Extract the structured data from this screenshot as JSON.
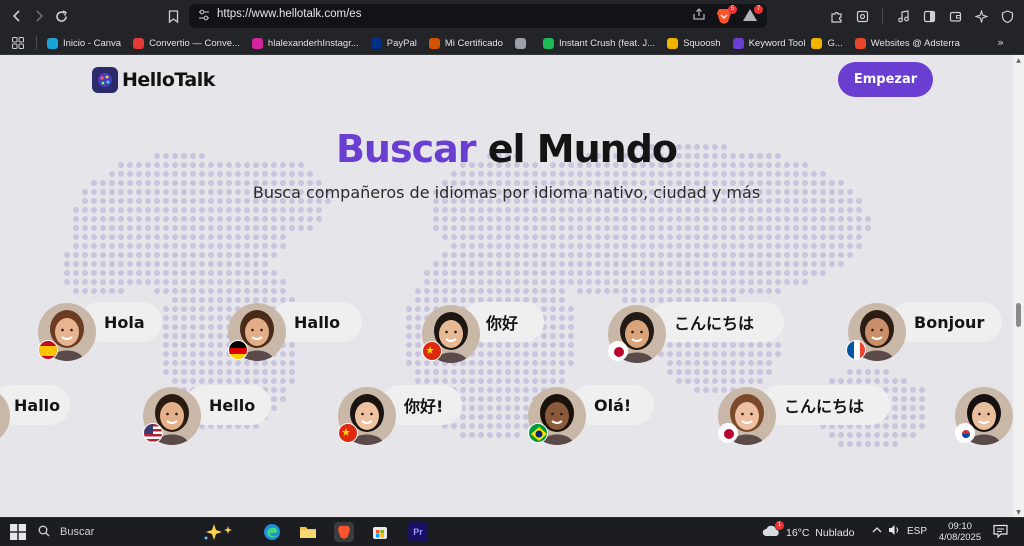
{
  "browser": {
    "url": "https://www.hellotalk.com/es",
    "brave_badge": "5",
    "aurora_badge": "7",
    "bookmarks": [
      {
        "label": "Inicio - Canva",
        "color": "#1ba4d8"
      },
      {
        "label": "Convertio — Conve...",
        "color": "#e53935"
      },
      {
        "label": "hlalexanderhInstagr...",
        "color": "#d6249f"
      },
      {
        "label": "PayPal",
        "color": "#003087"
      },
      {
        "label": "Mi Certificado",
        "color": "#d35400"
      },
      {
        "label": "",
        "color": "#9aa0a6"
      },
      {
        "label": "Instant Crush (feat. J...",
        "color": "#1db954"
      },
      {
        "label": "Squoosh",
        "color": "#f2b600"
      },
      {
        "label": "Keyword Tool",
        "color": "#6a3ed1"
      },
      {
        "label": "G...",
        "color": "#f4b400"
      },
      {
        "label": "Websites @ Adsterra",
        "color": "#e8462b"
      }
    ],
    "bookmarks_more": "»"
  },
  "page": {
    "brand": "HelloTalk",
    "cta_label": "Empezar",
    "title_accent": "Buscar",
    "title_rest": "el Mundo",
    "subtitle": "Busca compañeros de idiomas por idioma nativo, ciudad y más",
    "greetings": [
      {
        "text": "Hola",
        "flag": "es",
        "skin": "#e8b48f",
        "hair": "#6b3b22"
      },
      {
        "text": "Hallo",
        "flag": "de",
        "skin": "#e3ad88",
        "hair": "#4a2a18"
      },
      {
        "text": "你好",
        "flag": "cn",
        "skin": "#e6b893",
        "hair": "#1e1612"
      },
      {
        "text": "こんにちは",
        "flag": "jp",
        "skin": "#d9a47a",
        "hair": "#221a15"
      },
      {
        "text": "Bonjour",
        "flag": "fr",
        "skin": "#c98f68",
        "hair": "#2b1d14"
      },
      {
        "text": "Hallo",
        "flag": "de",
        "skin": "#e3ad88",
        "hair": "#4a2a18"
      },
      {
        "text": "Hello",
        "flag": "us",
        "skin": "#e3b08a",
        "hair": "#2a1b12"
      },
      {
        "text": "你好!",
        "flag": "cn",
        "skin": "#ecc2a0",
        "hair": "#1a1311"
      },
      {
        "text": "Olá!",
        "flag": "br",
        "skin": "#8a5a3c",
        "hair": "#1a110b"
      },
      {
        "text": "こんにちは",
        "flag": "jp",
        "skin": "#ecc0a0",
        "hair": "#7a4a2a"
      },
      {
        "text": "",
        "flag": "kr",
        "skin": "#e8c0a0",
        "hair": "#161110"
      }
    ]
  },
  "taskbar": {
    "search_label": "Buscar",
    "weather": "16°C  Nublado",
    "weather_badge": "1",
    "lang": "ESP",
    "time": "09:10",
    "date": "4/08/2025"
  },
  "colors": {
    "accent": "#6a3ed1",
    "map_dot": "#c9c5de",
    "page_bg": "#e6e6ea"
  }
}
